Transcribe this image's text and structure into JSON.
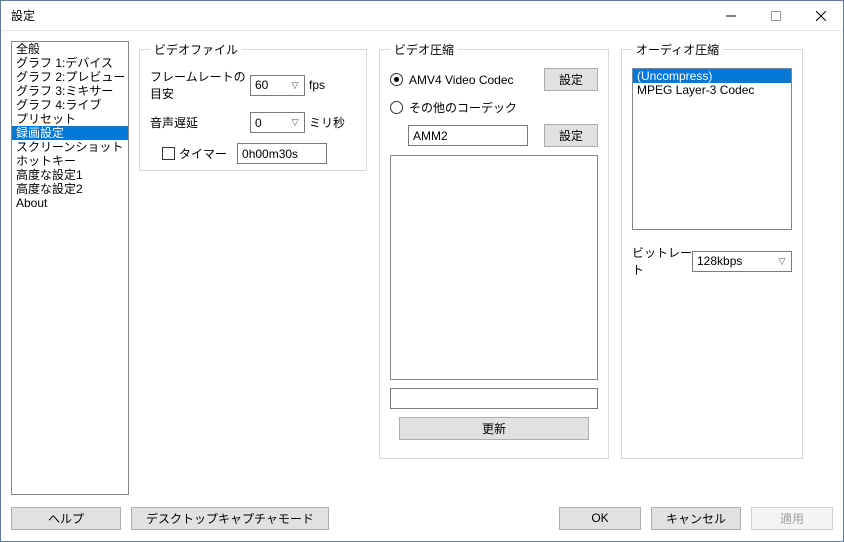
{
  "window": {
    "title": "設定"
  },
  "sidebar": {
    "items": [
      {
        "label": "全般"
      },
      {
        "label": "グラフ 1:デバイス"
      },
      {
        "label": "グラフ 2:プレビュー"
      },
      {
        "label": "グラフ 3:ミキサー"
      },
      {
        "label": "グラフ 4:ライブ"
      },
      {
        "label": "プリセット"
      },
      {
        "label": "録画設定",
        "selected": true
      },
      {
        "label": "スクリーンショット"
      },
      {
        "label": "ホットキー"
      },
      {
        "label": "高度な設定1"
      },
      {
        "label": "高度な設定2"
      },
      {
        "label": "About"
      }
    ]
  },
  "videofile": {
    "legend": "ビデオファイル",
    "framerate_label": "フレームレートの目安",
    "framerate_value": "60",
    "framerate_unit": "fps",
    "audiodelay_label": "音声遅延",
    "audiodelay_value": "0",
    "audiodelay_unit": "ミリ秒",
    "timer_label": "タイマー",
    "timer_value": "0h00m30s"
  },
  "videocomp": {
    "legend": "ビデオ圧縮",
    "radio_amv4": "AMV4 Video Codec",
    "radio_other": "その他のコーデック",
    "settings_btn": "設定",
    "codec_value": "AMM2",
    "update_btn": "更新"
  },
  "audio": {
    "legend": "オーディオ圧縮",
    "items": [
      {
        "label": "(Uncompress)",
        "selected": true
      },
      {
        "label": "MPEG Layer-3 Codec"
      }
    ],
    "bitrate_label": "ビットレート",
    "bitrate_value": "128kbps"
  },
  "footer": {
    "help": "ヘルプ",
    "desktop_capture": "デスクトップキャプチャモード",
    "ok": "OK",
    "cancel": "キャンセル",
    "apply": "適用"
  }
}
